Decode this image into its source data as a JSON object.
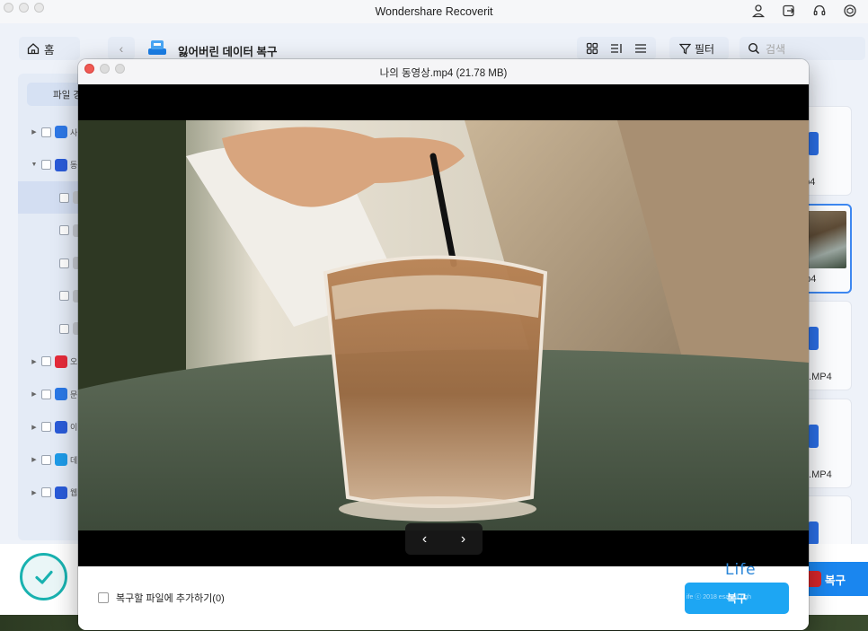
{
  "app": {
    "title": "Wondershare Recoverit"
  },
  "toolbar": {
    "home_label": "홈",
    "location_label": "잃어버린 데이터 복구",
    "filter_label": "필터",
    "search_placeholder": "검색"
  },
  "sidebar": {
    "tab_label": "파일 경",
    "rows": [
      {
        "label": "사",
        "icon": "photo-icon",
        "color": "#2e78e6",
        "expanded": false,
        "selected": false
      },
      {
        "label": "동",
        "icon": "video-icon",
        "color": "#2a5bd8",
        "expanded": true,
        "selected": false
      },
      {
        "label": "",
        "icon": "",
        "color": "",
        "expanded": false,
        "selected": true
      },
      {
        "label": "",
        "icon": "",
        "color": "",
        "expanded": false,
        "selected": false
      },
      {
        "label": "",
        "icon": "",
        "color": "",
        "expanded": false,
        "selected": false
      },
      {
        "label": "",
        "icon": "",
        "color": "",
        "expanded": false,
        "selected": false
      },
      {
        "label": "",
        "icon": "",
        "color": "",
        "expanded": false,
        "selected": false
      },
      {
        "label": "오",
        "icon": "audio-icon",
        "color": "#e52b3a",
        "expanded": false,
        "selected": false
      },
      {
        "label": "문",
        "icon": "document-icon",
        "color": "#2a78e6",
        "expanded": false,
        "selected": false
      },
      {
        "label": "이",
        "icon": "email-icon",
        "color": "#2a5bd8",
        "expanded": false,
        "selected": false
      },
      {
        "label": "데",
        "icon": "database-icon",
        "color": "#1e9be8",
        "expanded": false,
        "selected": false
      },
      {
        "label": "웹",
        "icon": "web-icon",
        "color": "#2a5bd8",
        "expanded": false,
        "selected": false
      }
    ]
  },
  "cards": [
    {
      "name": "mp4",
      "type": "blue"
    },
    {
      "name": "mp4",
      "type": "thumb"
    },
    {
      "name": "_D.MP4",
      "type": "blue"
    },
    {
      "name": "_D.MP4",
      "type": "blue"
    },
    {
      "name": "",
      "type": "blue"
    }
  ],
  "bottom": {
    "recover_label": "복구"
  },
  "modal": {
    "title": "나의 동영상.mp4 (21.78 MB)",
    "add_to_recover_label": "복구할 파일에 추가하기(0)",
    "recover_label": "복구",
    "watermark_life": "Life",
    "watermark_small": "ife ⓒ 2018 esar all righ"
  },
  "colors": {
    "accent": "#1a86ef",
    "modal_recover": "#1da6f3",
    "check_ring": "#19b2b0",
    "close_red": "#ef5a54"
  }
}
